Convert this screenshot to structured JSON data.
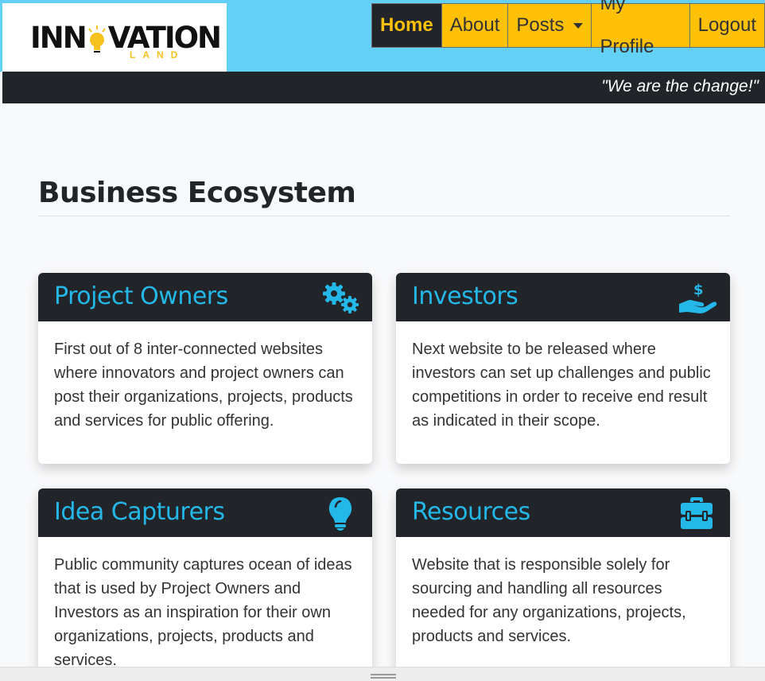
{
  "brand": {
    "logo_main_pre": "INN",
    "logo_main_post": "VATION",
    "logo_sub": "LAND"
  },
  "nav": {
    "items": [
      {
        "label": "Home",
        "active": true
      },
      {
        "label": "About"
      },
      {
        "label": "Posts",
        "dropdown": true
      },
      {
        "label": "My Profile"
      },
      {
        "label": "Logout"
      }
    ]
  },
  "tagline": "\"We are the change!\"",
  "main": {
    "heading": "Business Ecosystem",
    "cards": [
      {
        "title": "Project Owners",
        "icon": "gears-icon",
        "body": "First out of 8 inter-connected websites where innovators and project owners can post their organizations, projects, products and services for public offering."
      },
      {
        "title": "Investors",
        "icon": "hand-dollar-icon",
        "body": "Next website to be released where investors can set up challenges and public competitions in order to receive end result as indicated in their scope."
      },
      {
        "title": "Idea Capturers",
        "icon": "lightbulb-icon",
        "body": "Public community captures ocean of ideas that is used by Project Owners and Investors as an inspiration for their own organizations, projects, products and services."
      },
      {
        "title": "Resources",
        "icon": "toolbox-icon",
        "body": "Website that is responsible solely for sourcing and handling all resources needed for any organizations, projects, products and services."
      }
    ]
  },
  "colors": {
    "accent_blue": "#23b8e8",
    "nav_yellow": "#ffc107",
    "dark": "#212529",
    "header_sky": "#63d0f5"
  }
}
